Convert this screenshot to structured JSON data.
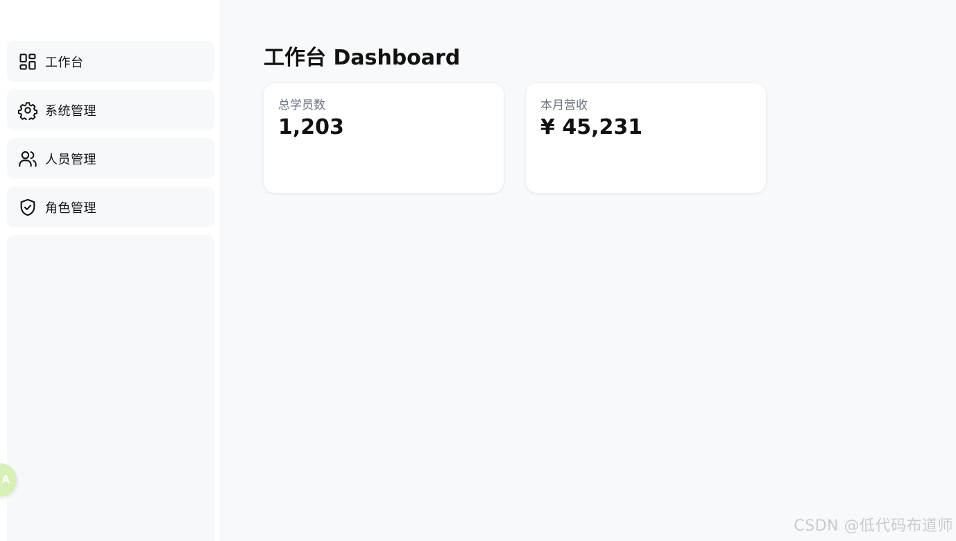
{
  "sidebar": {
    "items": [
      {
        "label": "工作台",
        "icon": "dashboard-grid-icon"
      },
      {
        "label": "系统管理",
        "icon": "gear-icon"
      },
      {
        "label": "人员管理",
        "icon": "users-icon"
      },
      {
        "label": "角色管理",
        "icon": "shield-check-icon"
      }
    ]
  },
  "main": {
    "title": "工作台 Dashboard",
    "stats": [
      {
        "label": "总学员数",
        "value": "1,203"
      },
      {
        "label": "本月营收",
        "value": "¥ 45,231"
      }
    ]
  },
  "watermark": "CSDN @低代码布道师",
  "floating_button": {
    "glyph": "A",
    "icon": "translate-icon",
    "color": "#d7f0b8"
  },
  "colors": {
    "sidebar_item_bg": "#f7f8fa",
    "main_bg": "#f8f9fb",
    "card_bg": "#ffffff",
    "muted_text": "#6b7280"
  }
}
